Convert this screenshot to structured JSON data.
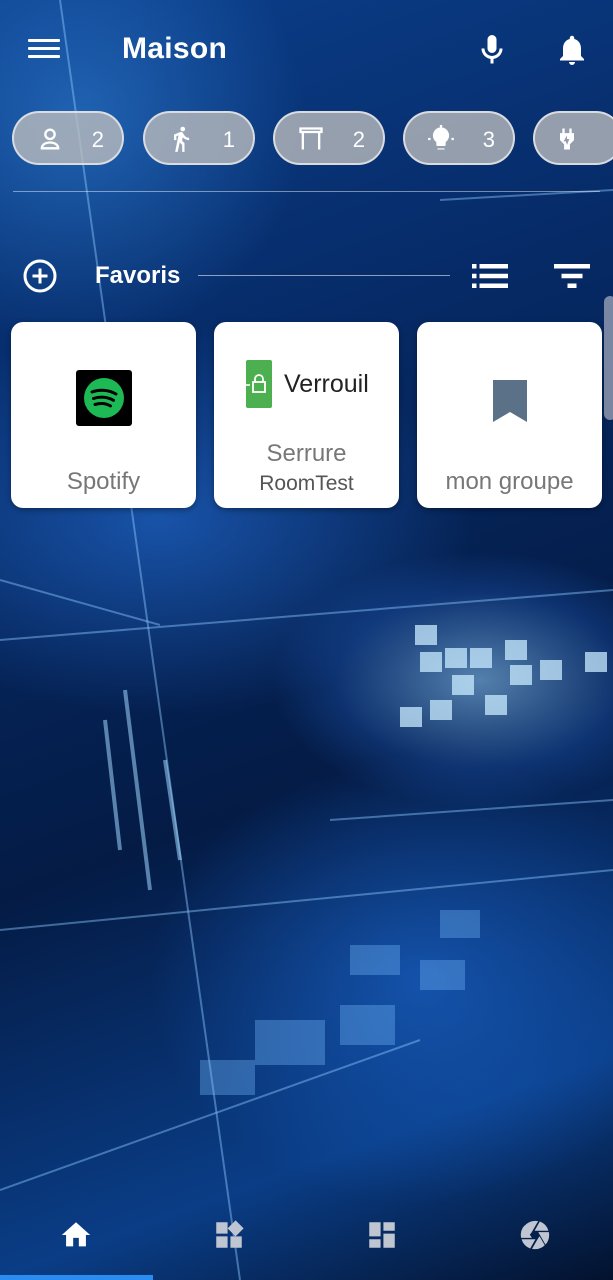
{
  "header": {
    "title": "Maison",
    "menu_icon": "hamburger-menu-icon",
    "mic_icon": "microphone-icon",
    "bell_icon": "bell-icon"
  },
  "chips": [
    {
      "icon": "person-icon",
      "count": "2"
    },
    {
      "icon": "walking-person-icon",
      "count": "1"
    },
    {
      "icon": "shutter-icon",
      "count": "2"
    },
    {
      "icon": "lightbulb-icon",
      "count": "3"
    },
    {
      "icon": "plug-icon",
      "count": ""
    }
  ],
  "favorites": {
    "label": "Favoris",
    "add_icon": "add-circle-icon",
    "list_icon": "list-view-icon",
    "sort_icon": "sort-filter-icon",
    "cards": [
      {
        "icon": "spotify-icon",
        "label": "Spotify"
      },
      {
        "icon": "lock-icon",
        "state": "Verrouil",
        "label": "Serrure",
        "sublabel": "RoomTest"
      },
      {
        "icon": "bookmark-icon",
        "label": "mon groupe"
      }
    ]
  },
  "bottom_nav": [
    {
      "icon": "home-icon",
      "active": true
    },
    {
      "icon": "widgets-icon",
      "active": false
    },
    {
      "icon": "dashboard-icon",
      "active": false
    },
    {
      "icon": "camera-aperture-icon",
      "active": false
    }
  ],
  "colors": {
    "accent": "#2a8cf0",
    "spotify_green": "#1db954",
    "lock_green": "#4caf50",
    "bookmark": "#5b7188",
    "chip_bg": "#bebebe"
  }
}
